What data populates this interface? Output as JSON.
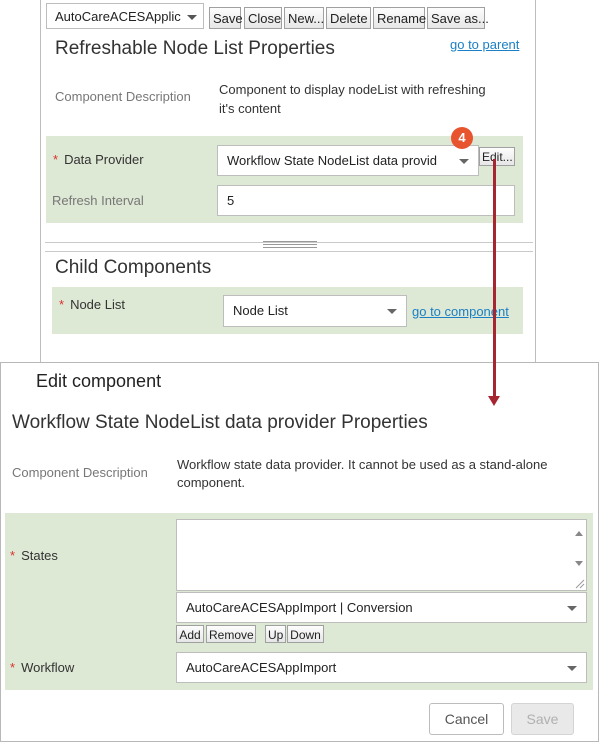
{
  "parent_panel": {
    "toolbar": {
      "selector_value": "AutoCareACESApplic",
      "buttons": [
        "Save",
        "Close",
        "New...",
        "Delete",
        "Rename",
        "Save as..."
      ]
    },
    "title": "Refreshable Node List Properties",
    "go_to_parent": "go to parent",
    "component_description_label": "Component Description",
    "component_description_line1": "Component to display nodeList with refreshing",
    "component_description_line2": "it's content",
    "required_marker": "*",
    "data_provider_label": "Data Provider",
    "data_provider_value": "Workflow State NodeList data provid",
    "edit_button": "Edit...",
    "callout_number": "4",
    "refresh_interval_label": "Refresh Interval",
    "refresh_interval_value": "5",
    "child_components_title": "Child Components",
    "node_list_label": "Node List",
    "node_list_value": "Node List",
    "go_to_component": "go to component"
  },
  "dialog": {
    "title": "Edit component",
    "heading": "Workflow State NodeList data provider Properties",
    "component_description_label": "Component Description",
    "component_description_line1": "Workflow state data provider. It cannot be used as a stand-alone",
    "component_description_line2": "component.",
    "required_marker": "*",
    "states_label": "States",
    "states_select_value": "AutoCareACESAppImport | Conversion",
    "list_buttons": [
      "Add",
      "Remove",
      "Up",
      "Down"
    ],
    "workflow_label": "Workflow",
    "workflow_value": "AutoCareACESAppImport",
    "cancel_button": "Cancel",
    "save_button": "Save"
  },
  "colors": {
    "accent_link": "#1a7fc4",
    "required": "#d9312b",
    "form_band": "#dde8d5",
    "callout": "#e8542e",
    "connector": "#a52630"
  }
}
